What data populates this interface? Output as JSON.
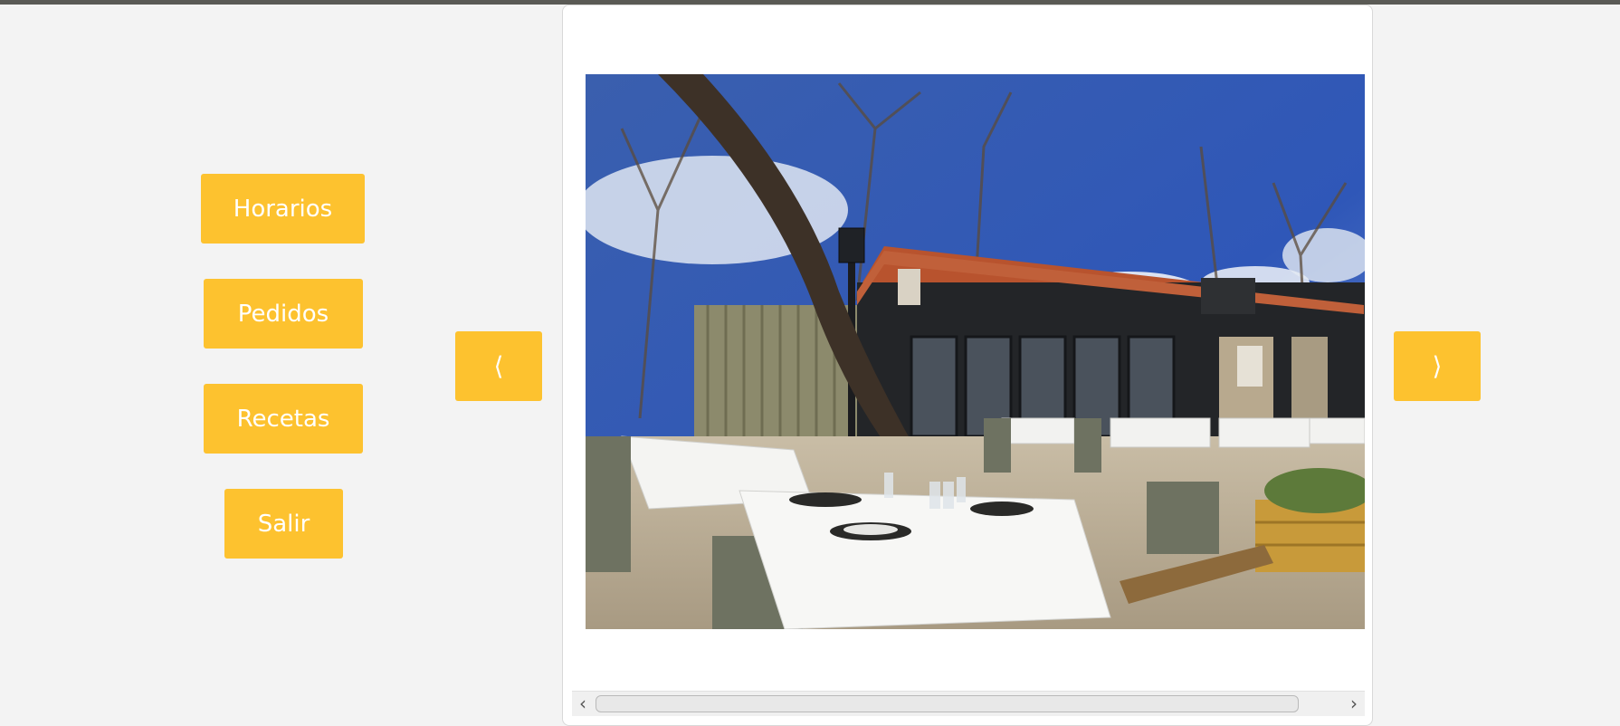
{
  "menu": {
    "horarios": "Horarios",
    "pedidos": "Pedidos",
    "recetas": "Recetas",
    "salir": "Salir"
  },
  "nav": {
    "prev": "⟨",
    "next": "⟩"
  },
  "scrollbar": {
    "left_arrow": "‹",
    "right_arrow": "›"
  },
  "colors": {
    "accent": "#fdc22f",
    "background": "#f3f3f3",
    "panel": "#ffffff"
  },
  "icons": {
    "prev": "chevron-left-icon",
    "next": "chevron-right-icon"
  }
}
